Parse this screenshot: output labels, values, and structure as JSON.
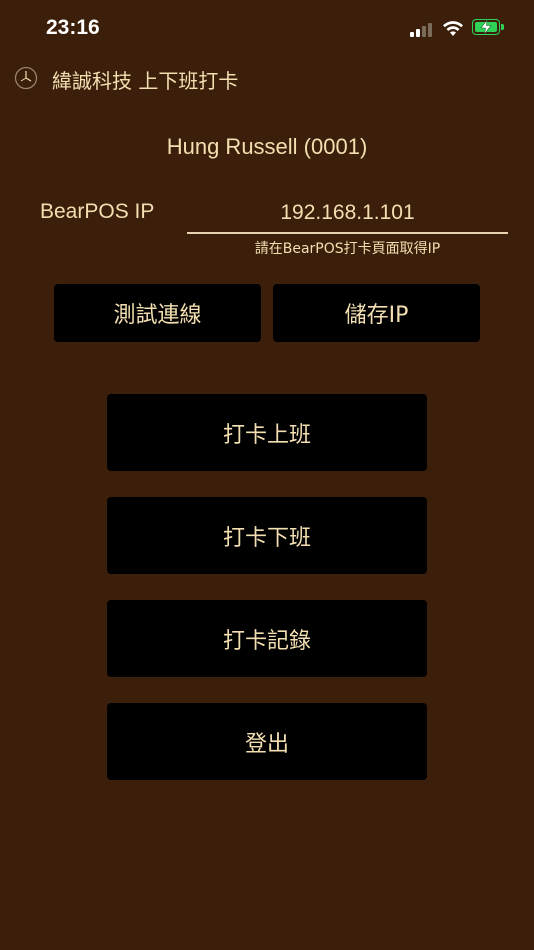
{
  "status_bar": {
    "time": "23:16",
    "signal_icon": "cellular-signal-icon",
    "wifi_icon": "wifi-icon",
    "battery_icon": "battery-charging-icon",
    "battery_color": "#2fd158"
  },
  "header": {
    "icon": "clock-icon",
    "title": "緯誠科技 上下班打卡"
  },
  "user": {
    "name": "Hung Russell (0001)"
  },
  "ip_field": {
    "label": "BearPOS IP",
    "value": "192.168.1.101",
    "hint": "請在BearPOS打卡頁面取得IP"
  },
  "actions": {
    "test_connection": "測試連線",
    "save_ip": "儲存IP",
    "clock_in": "打卡上班",
    "clock_out": "打卡下班",
    "records": "打卡記錄",
    "logout": "登出"
  },
  "colors": {
    "background": "#3b1f0a",
    "text": "#f3dfb1",
    "button": "#000000"
  }
}
